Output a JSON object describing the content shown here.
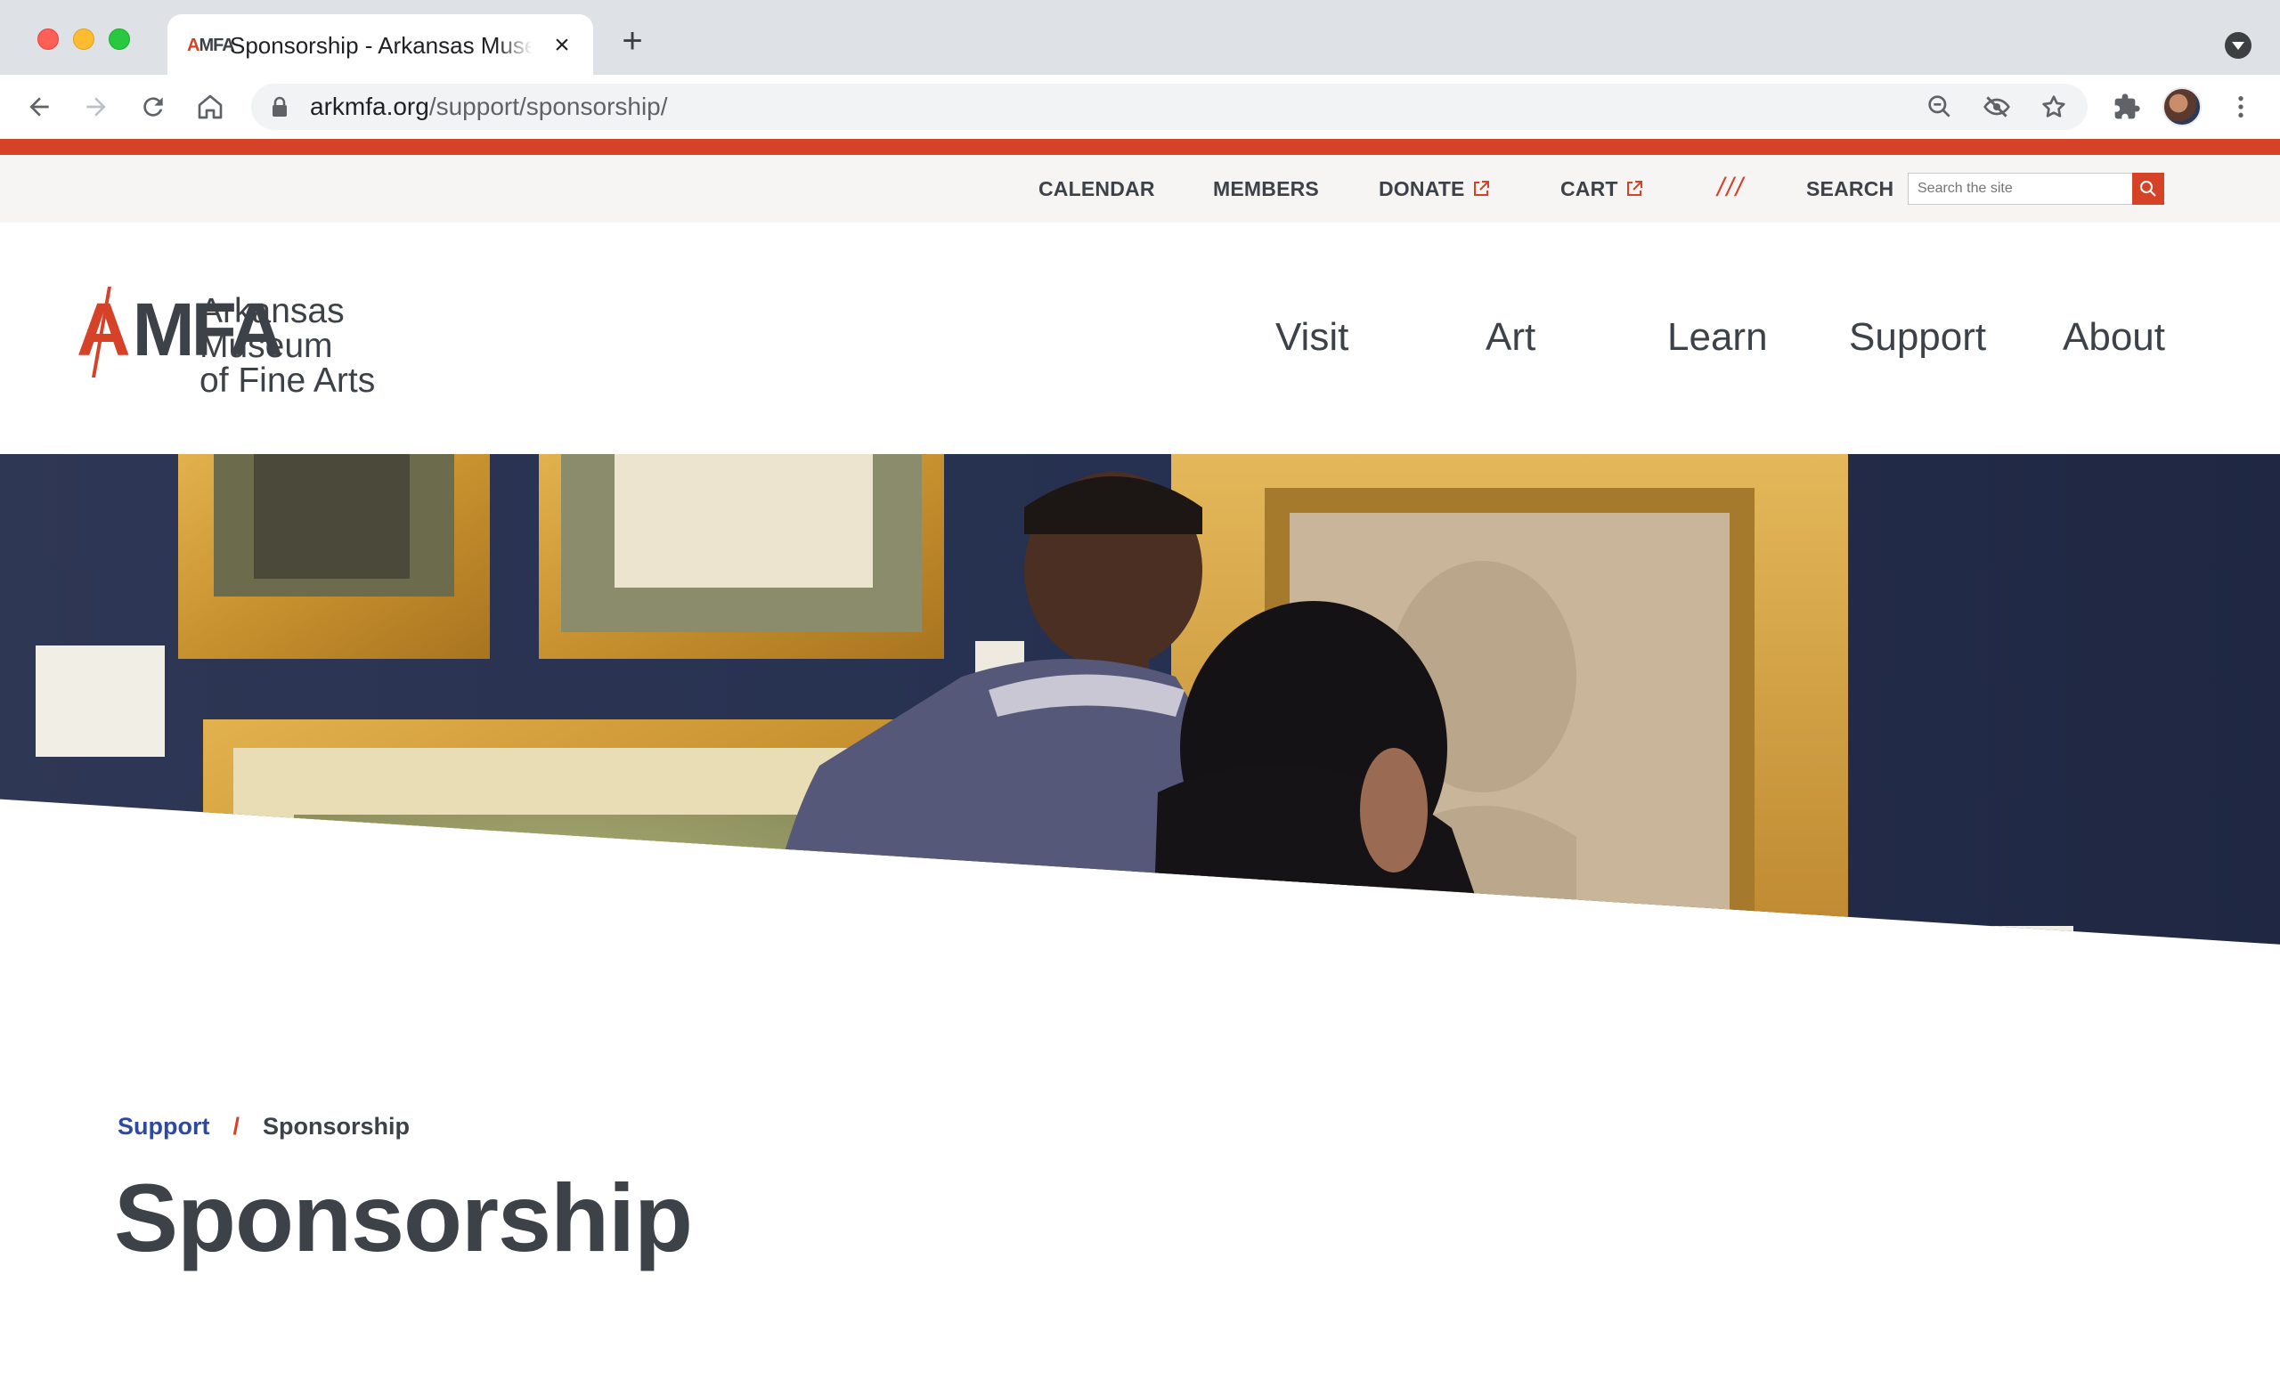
{
  "browser": {
    "tab": {
      "title": "Sponsorship - Arkansas Museum of Fine Arts",
      "favicon_a": "A",
      "favicon_mfa": "MFA"
    },
    "address_bar": {
      "host": "arkmfa.org",
      "path": "/support/sponsorship/"
    },
    "icons": [
      "back-icon",
      "forward-icon",
      "reload-icon",
      "home-icon",
      "lock-icon",
      "zoom-out-icon",
      "eye-off-icon",
      "star-icon",
      "extensions-icon",
      "profile-avatar",
      "more-menu-icon"
    ]
  },
  "utility_nav": {
    "items": [
      {
        "label": "CALENDAR"
      },
      {
        "label": "MEMBERS"
      },
      {
        "label": "DONATE"
      },
      {
        "label": "CART"
      }
    ],
    "divider": "///",
    "search_label": "SEARCH",
    "search_placeholder": "Search the site"
  },
  "logo": {
    "mark_a": "A",
    "mark_mfa": "MFA",
    "line1": "Arkansas Museum",
    "line2": "of Fine Arts"
  },
  "main_nav": [
    {
      "label": "Visit"
    },
    {
      "label": "Art"
    },
    {
      "label": "Learn"
    },
    {
      "label": "Support"
    },
    {
      "label": "About"
    }
  ],
  "breadcrumb": {
    "parent": "Support",
    "separator": "/",
    "current": "Sponsorship"
  },
  "page_title": "Sponsorship",
  "colors": {
    "accent": "#d64227",
    "text": "#3d4148",
    "link": "#2d4aa0",
    "utility_bg": "#f6f5f3",
    "hero_wall": "#2b3452"
  }
}
